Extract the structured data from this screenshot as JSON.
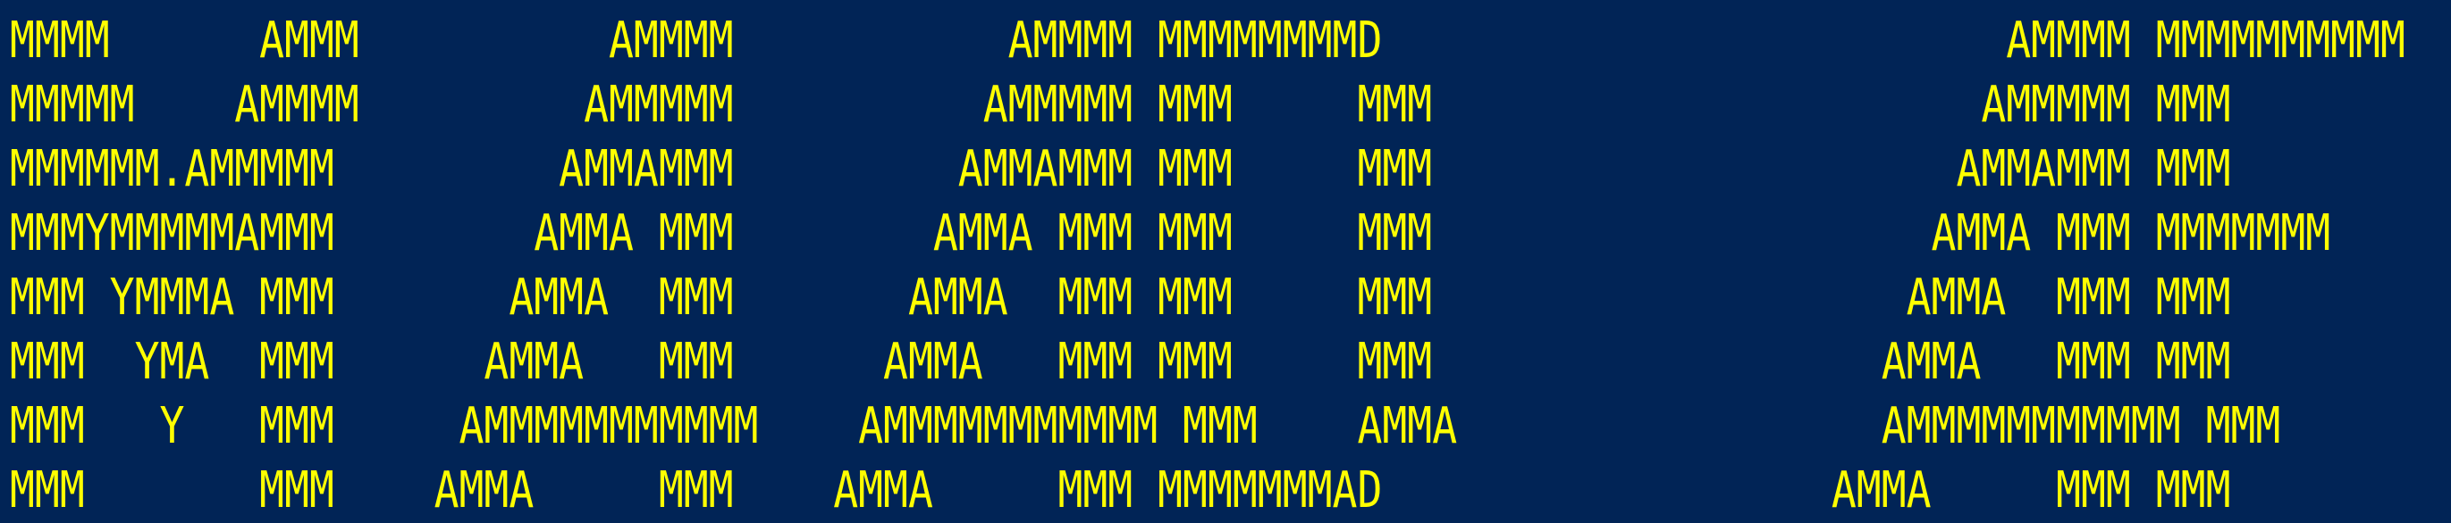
{
  "colors": {
    "background": "#012456",
    "foreground": "#ffff00"
  },
  "terminal": {
    "banner_lines": [
      "MMMM      AMMM          AMMMM           AMMMM MMMMMMMMD                         AMMMM MMMMMMMMMM",
      "MMMMM    AMMMM         AMMMMM          AMMMMM MMM     MMM                      AMMMMM MMM",
      "MMMMMM.AMMMMM         AMMAMMM         AMMAMMM MMM     MMM                     AMMAMMM MMM",
      "MMMYMMMMMAMMM        AMMA MMM        AMMA MMM MMM     MMM                    AMMA MMM MMMMMMM",
      "MMM YMMMA MMM       AMMA  MMM       AMMA  MMM MMM     MMM                   AMMA  MMM MMM",
      "MMM  YMA  MMM      AMMA   MMM      AMMA   MMM MMM     MMM                  AMMA   MMM MMM",
      "MMM   Y   MMM     AMMMMMMMMMMM    AMMMMMMMMMMM MMM    AMMA                 AMMMMMMMMMMM MMM",
      "MMM       MMM    AMMA     MMM    AMMA     MMM MMMMMMMAD                  AMMA     MMM MMM"
    ]
  }
}
